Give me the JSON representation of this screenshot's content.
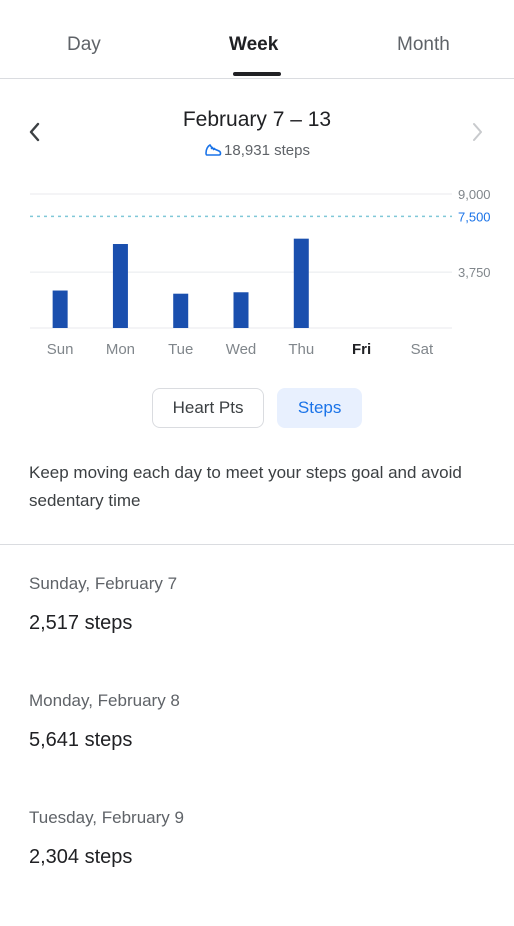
{
  "tabs": [
    {
      "label": "Day"
    },
    {
      "label": "Week"
    },
    {
      "label": "Month"
    }
  ],
  "header": {
    "title": "February 7 – 13",
    "subtitle": "18,931 steps"
  },
  "chart_data": {
    "type": "bar",
    "categories": [
      "Sun",
      "Mon",
      "Tue",
      "Wed",
      "Thu",
      "Fri",
      "Sat"
    ],
    "highlight_category": "Fri",
    "values": [
      2517,
      5641,
      2304,
      2400,
      6000,
      0,
      0
    ],
    "ylim": [
      0,
      9000
    ],
    "yticks": [
      "9,000",
      "3,750"
    ],
    "goal": {
      "value": 7500,
      "label": "7,500"
    },
    "colors": {
      "bar": "#1a4fae",
      "goal": "#1a73e8",
      "grid": "#e8eaed"
    }
  },
  "chips": {
    "heart": "Heart Pts",
    "steps": "Steps"
  },
  "info_text": "Keep moving each day to meet your steps goal and avoid sedentary time",
  "days": [
    {
      "date": "Sunday, February 7",
      "steps": "2,517 steps"
    },
    {
      "date": "Monday, February 8",
      "steps": "5,641 steps"
    },
    {
      "date": "Tuesday, February 9",
      "steps": "2,304 steps"
    }
  ]
}
